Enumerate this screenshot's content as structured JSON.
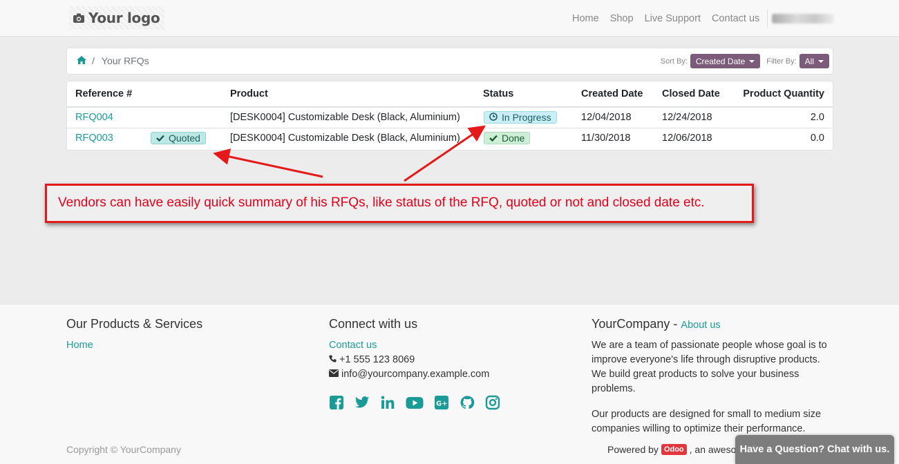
{
  "header": {
    "logo_text": "Your logo",
    "nav": [
      "Home",
      "Shop",
      "Live Support",
      "Contact us"
    ]
  },
  "breadcrumb": {
    "current": "Your RFQs"
  },
  "sort": {
    "label": "Sort By:",
    "value": "Created Date"
  },
  "filter": {
    "label": "Filter By:",
    "value": "All"
  },
  "table": {
    "headers": [
      "Reference #",
      "Product",
      "Status",
      "Created Date",
      "Closed Date",
      "Product Quantity"
    ],
    "rows": [
      {
        "ref": "RFQ004",
        "quoted": "",
        "product": "[DESK0004] Customizable Desk (Black, Aluminium)",
        "status": "In Progress",
        "created": "12/04/2018",
        "closed": "12/24/2018",
        "qty": "2.0"
      },
      {
        "ref": "RFQ003",
        "quoted": "Quoted",
        "product": "[DESK0004] Customizable Desk (Black, Aluminium)",
        "status": "Done",
        "created": "11/30/2018",
        "closed": "12/06/2018",
        "qty": "0.0"
      }
    ]
  },
  "annotation": {
    "text": "Vendors can have easily quick summary of his RFQs, like status of the RFQ, quoted or not and closed date etc."
  },
  "footer": {
    "col1": {
      "title": "Our Products & Services",
      "link": "Home"
    },
    "col2": {
      "title": "Connect with us",
      "link": "Contact us",
      "phone": "+1 555 123 8069",
      "email": "info@yourcompany.example.com"
    },
    "col3": {
      "title": "YourCompany",
      "title_sep": " - ",
      "link": "About us",
      "p1": "We are a team of passionate people whose goal is to improve everyone's life through disruptive products. We build great products to solve your business problems.",
      "p2": "Our products are designed for small to medium size companies willing to optimize their performance."
    },
    "copyright": "Copyright © YourCompany",
    "powered_by": "Powered by",
    "odoo": "Odoo",
    "powered_rest": ", an awesome"
  },
  "chat_button": "Have a Question? Chat with us.",
  "colors": {
    "accent": "#1b9b98",
    "dropdown": "#7c5a79",
    "annotation": "#e41a1a"
  }
}
